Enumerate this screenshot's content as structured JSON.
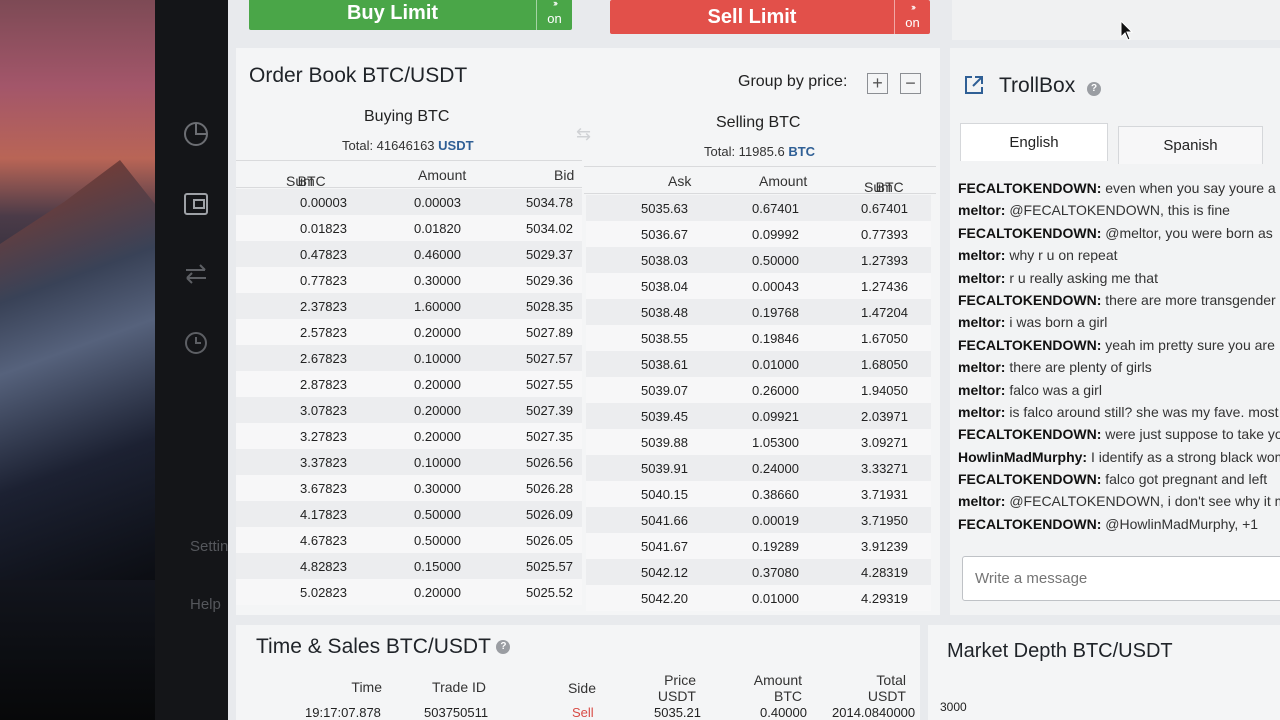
{
  "sidebar": {
    "settings_label": "Settings",
    "help_label": "Help"
  },
  "trade_buttons": {
    "buy": {
      "label": "Buy Limit",
      "toggle": "on",
      "color": "#4aa648"
    },
    "sell": {
      "label": "Sell Limit",
      "toggle": "on",
      "color": "#e2504a"
    }
  },
  "orderbook": {
    "title": "Order Book BTC/USDT",
    "group_by_label": "Group by price:",
    "buying": {
      "title": "Buying BTC",
      "total_label": "Total: 41646163",
      "total_unit": "USDT"
    },
    "selling": {
      "title": "Selling BTC",
      "total_label": "Total: 11985.6",
      "total_unit": "BTC"
    },
    "bid_headers": {
      "sum": "Sum",
      "sum_unit": "BTC",
      "amount": "Amount",
      "bid": "Bid"
    },
    "ask_headers": {
      "ask": "Ask",
      "amount": "Amount",
      "sum": "Sum",
      "sum_unit": "BTC"
    },
    "bids": [
      [
        "0.00003",
        "0.00003",
        "5034.78"
      ],
      [
        "0.01823",
        "0.01820",
        "5034.02"
      ],
      [
        "0.47823",
        "0.46000",
        "5029.37"
      ],
      [
        "0.77823",
        "0.30000",
        "5029.36"
      ],
      [
        "2.37823",
        "1.60000",
        "5028.35"
      ],
      [
        "2.57823",
        "0.20000",
        "5027.89"
      ],
      [
        "2.67823",
        "0.10000",
        "5027.57"
      ],
      [
        "2.87823",
        "0.20000",
        "5027.55"
      ],
      [
        "3.07823",
        "0.20000",
        "5027.39"
      ],
      [
        "3.27823",
        "0.20000",
        "5027.35"
      ],
      [
        "3.37823",
        "0.10000",
        "5026.56"
      ],
      [
        "3.67823",
        "0.30000",
        "5026.28"
      ],
      [
        "4.17823",
        "0.50000",
        "5026.09"
      ],
      [
        "4.67823",
        "0.50000",
        "5026.05"
      ],
      [
        "4.82823",
        "0.15000",
        "5025.57"
      ],
      [
        "5.02823",
        "0.20000",
        "5025.52"
      ]
    ],
    "asks": [
      [
        "5035.63",
        "0.67401",
        "0.67401"
      ],
      [
        "5036.67",
        "0.09992",
        "0.77393"
      ],
      [
        "5038.03",
        "0.50000",
        "1.27393"
      ],
      [
        "5038.04",
        "0.00043",
        "1.27436"
      ],
      [
        "5038.48",
        "0.19768",
        "1.47204"
      ],
      [
        "5038.55",
        "0.19846",
        "1.67050"
      ],
      [
        "5038.61",
        "0.01000",
        "1.68050"
      ],
      [
        "5039.07",
        "0.26000",
        "1.94050"
      ],
      [
        "5039.45",
        "0.09921",
        "2.03971"
      ],
      [
        "5039.88",
        "1.05300",
        "3.09271"
      ],
      [
        "5039.91",
        "0.24000",
        "3.33271"
      ],
      [
        "5040.15",
        "0.38660",
        "3.71931"
      ],
      [
        "5041.66",
        "0.00019",
        "3.71950"
      ],
      [
        "5041.67",
        "0.19289",
        "3.91239"
      ],
      [
        "5042.12",
        "0.37080",
        "4.28319"
      ],
      [
        "5042.20",
        "0.01000",
        "4.29319"
      ]
    ]
  },
  "trollbox": {
    "title": "TrollBox",
    "tabs": [
      "English",
      "Spanish"
    ],
    "messages": [
      {
        "user": "FECALTOKENDOWN:",
        "text": " even when you say youre a"
      },
      {
        "user": "meltor:",
        "text": " @FECALTOKENDOWN, this is fine"
      },
      {
        "user": "FECALTOKENDOWN:",
        "text": " @meltor, you were born as"
      },
      {
        "user": "meltor:",
        "text": " why r u on repeat"
      },
      {
        "user": "meltor:",
        "text": " r u really asking me that"
      },
      {
        "user": "FECALTOKENDOWN:",
        "text": " there are more transgender"
      },
      {
        "user": "meltor:",
        "text": " i was born a girl"
      },
      {
        "user": "FECALTOKENDOWN:",
        "text": " yeah im pretty sure you are"
      },
      {
        "user": "meltor:",
        "text": " there are plenty of girls"
      },
      {
        "user": "meltor:",
        "text": " falco was a girl"
      },
      {
        "user": "meltor:",
        "text": " is falco around still? she was my fave. most"
      },
      {
        "user": "FECALTOKENDOWN:",
        "text": " were just suppose to take yo"
      },
      {
        "user": "HowlinMadMurphy:",
        "text": " I identify as a strong black wom"
      },
      {
        "user": "FECALTOKENDOWN:",
        "text": " falco got pregnant and left"
      },
      {
        "user": "meltor:",
        "text": " @FECALTOKENDOWN, i don't see why it m"
      },
      {
        "user": "FECALTOKENDOWN:",
        "text": " @HowlinMadMurphy, +1"
      }
    ],
    "input_placeholder": "Write a message"
  },
  "time_sales": {
    "title": "Time & Sales BTC/USDT",
    "headers": {
      "time": "Time",
      "trade_id": "Trade ID",
      "side": "Side",
      "price": "Price",
      "price_unit": "USDT",
      "amount": "Amount",
      "amount_unit": "BTC",
      "total": "Total",
      "total_unit": "USDT"
    },
    "row": {
      "time": "19:17:07.878",
      "trade_id": "503750511",
      "side": "Sell",
      "price": "5035.21",
      "amount": "0.40000",
      "total": "2014.0840000"
    }
  },
  "depth": {
    "title": "Market Depth BTC/USDT",
    "y_tick": "3000"
  }
}
